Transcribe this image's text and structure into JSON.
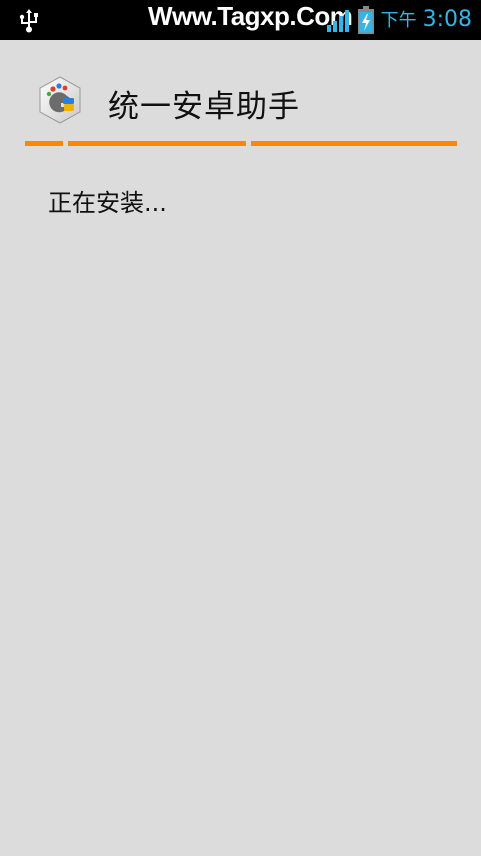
{
  "status_bar": {
    "watermark": "Www.Tagxp.Com",
    "ampm": "下午",
    "time": "3:08",
    "icons": [
      "usb-icon",
      "signal-icon",
      "battery-charging-icon"
    ],
    "accent_color": "#33b5e5"
  },
  "header": {
    "title": "统一安卓助手",
    "icon": "app-logo-icon",
    "divider_color": "#ff8800"
  },
  "main": {
    "status_text": "正在安装..."
  }
}
